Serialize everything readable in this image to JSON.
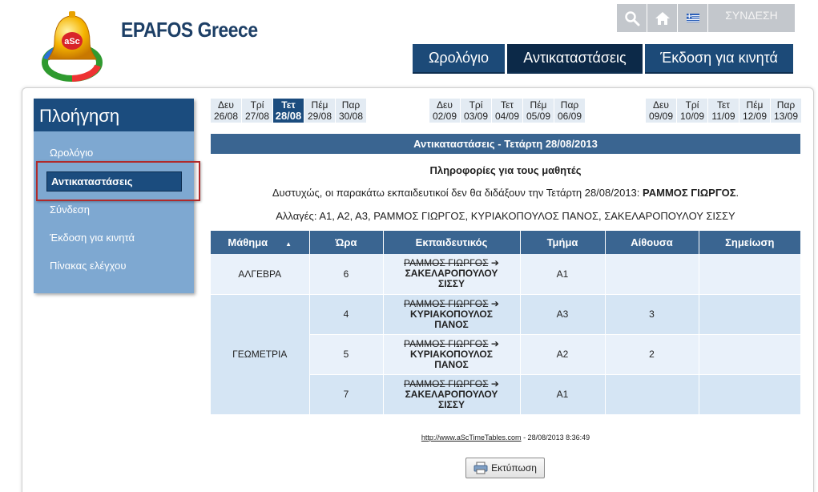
{
  "header": {
    "site_title": "EPAFOS Greece",
    "login_label": "ΣΥΝΔΕΣΗ",
    "menu": [
      "Ωρολόγιο",
      "Αντικαταστάσεις",
      "Έκδοση για κινητά"
    ],
    "active_menu": "Αντικαταστάσεις"
  },
  "sidebar": {
    "title": "Πλοήγηση",
    "items": [
      "Ωρολόγιο",
      "Αντικαταστάσεις",
      "Σύνδεση",
      "Έκδοση για κινητά",
      "Πίνακας ελέγχου"
    ],
    "active_item": "Αντικαταστάσεις"
  },
  "days": {
    "week1": [
      {
        "name": "Δευ",
        "date": "26/08"
      },
      {
        "name": "Τρί",
        "date": "27/08"
      },
      {
        "name": "Τετ",
        "date": "28/08",
        "selected": true
      },
      {
        "name": "Πέμ",
        "date": "29/08"
      },
      {
        "name": "Παρ",
        "date": "30/08"
      }
    ],
    "week2": [
      {
        "name": "Δευ",
        "date": "02/09"
      },
      {
        "name": "Τρί",
        "date": "03/09"
      },
      {
        "name": "Τετ",
        "date": "04/09"
      },
      {
        "name": "Πέμ",
        "date": "05/09"
      },
      {
        "name": "Παρ",
        "date": "06/09"
      }
    ],
    "week3": [
      {
        "name": "Δευ",
        "date": "09/09"
      },
      {
        "name": "Τρί",
        "date": "10/09"
      },
      {
        "name": "Τετ",
        "date": "11/09"
      },
      {
        "name": "Πέμ",
        "date": "12/09"
      },
      {
        "name": "Παρ",
        "date": "13/09"
      }
    ]
  },
  "content": {
    "banner": "Αντικαταστάσεις - Τετάρτη 28/08/2013",
    "info_title": "Πληροφορίες για τους μαθητές",
    "absent_text": "Δυστυχώς, οι παρακάτω εκπαιδευτικοί δεν θα διδάξουν την Τετάρτη 28/08/2013: ",
    "absent_names": "ΡΑΜΜΟΣ ΓΙΩΡΓΟΣ",
    "absent_end": ".",
    "changes_text": "Αλλαγές: Α1, Α2, Α3, ΡΑΜΜΟΣ ΓΙΩΡΓΟΣ, ΚΥΡΙΑΚΟΠΟΥΛΟΣ ΠΑΝΟΣ, ΣΑΚΕΛΑΡΟΠΟΥΛΟΥ ΣΙΣΣΥ"
  },
  "table": {
    "columns": [
      "Μάθημα",
      "Ώρα",
      "Εκπαιδευτικός",
      "Τμήμα",
      "Αίθουσα",
      "Σημείωση"
    ],
    "rows": [
      {
        "subject": "ΑΛΓΕΒΡΑ",
        "hour": "6",
        "old_teacher": "ΡΑΜΜΟΣ ΓΙΩΡΓΟΣ",
        "arrow": "➔",
        "new_teacher_1": "ΣΑΚΕΛΑΡΟΠΟΥΛΟΥ",
        "new_teacher_2": "ΣΙΣΣΥ",
        "class": "Α1",
        "room": "",
        "note": ""
      },
      {
        "subject": "ΓΕΩΜΕΤΡΙΑ",
        "hour": "4",
        "old_teacher": "ΡΑΜΜΟΣ ΓΙΩΡΓΟΣ",
        "arrow": "➔",
        "new_teacher_1": "ΚΥΡΙΑΚΟΠΟΥΛΟΣ",
        "new_teacher_2": "ΠΑΝΟΣ",
        "class": "Α3",
        "room": "3",
        "note": ""
      },
      {
        "subject": "",
        "hour": "5",
        "old_teacher": "ΡΑΜΜΟΣ ΓΙΩΡΓΟΣ",
        "arrow": "➔",
        "new_teacher_1": "ΚΥΡΙΑΚΟΠΟΥΛΟΣ",
        "new_teacher_2": "ΠΑΝΟΣ",
        "class": "Α2",
        "room": "2",
        "note": ""
      },
      {
        "subject": "",
        "hour": "7",
        "old_teacher": "ΡΑΜΜΟΣ ΓΙΩΡΓΟΣ",
        "arrow": "➔",
        "new_teacher_1": "ΣΑΚΕΛΑΡΟΠΟΥΛΟΥ",
        "new_teacher_2": "ΣΙΣΣΥ",
        "class": "Α1",
        "room": "",
        "note": ""
      }
    ]
  },
  "footer": {
    "link": "http://www.aScTimeTables.com",
    "timestamp": " - 28/08/2013 8:36:49"
  },
  "print_label": "Εκτύπωση",
  "icons": {
    "search": "search-icon",
    "home": "home-icon",
    "flag": "greek-flag-icon",
    "sort": "sort-up-icon",
    "printer": "printer-icon"
  },
  "colors": {
    "primary": "#1b4c7e",
    "table_header": "#3a6591",
    "sidebar": "#7ea8d1",
    "highlight": "#b02a2a"
  }
}
